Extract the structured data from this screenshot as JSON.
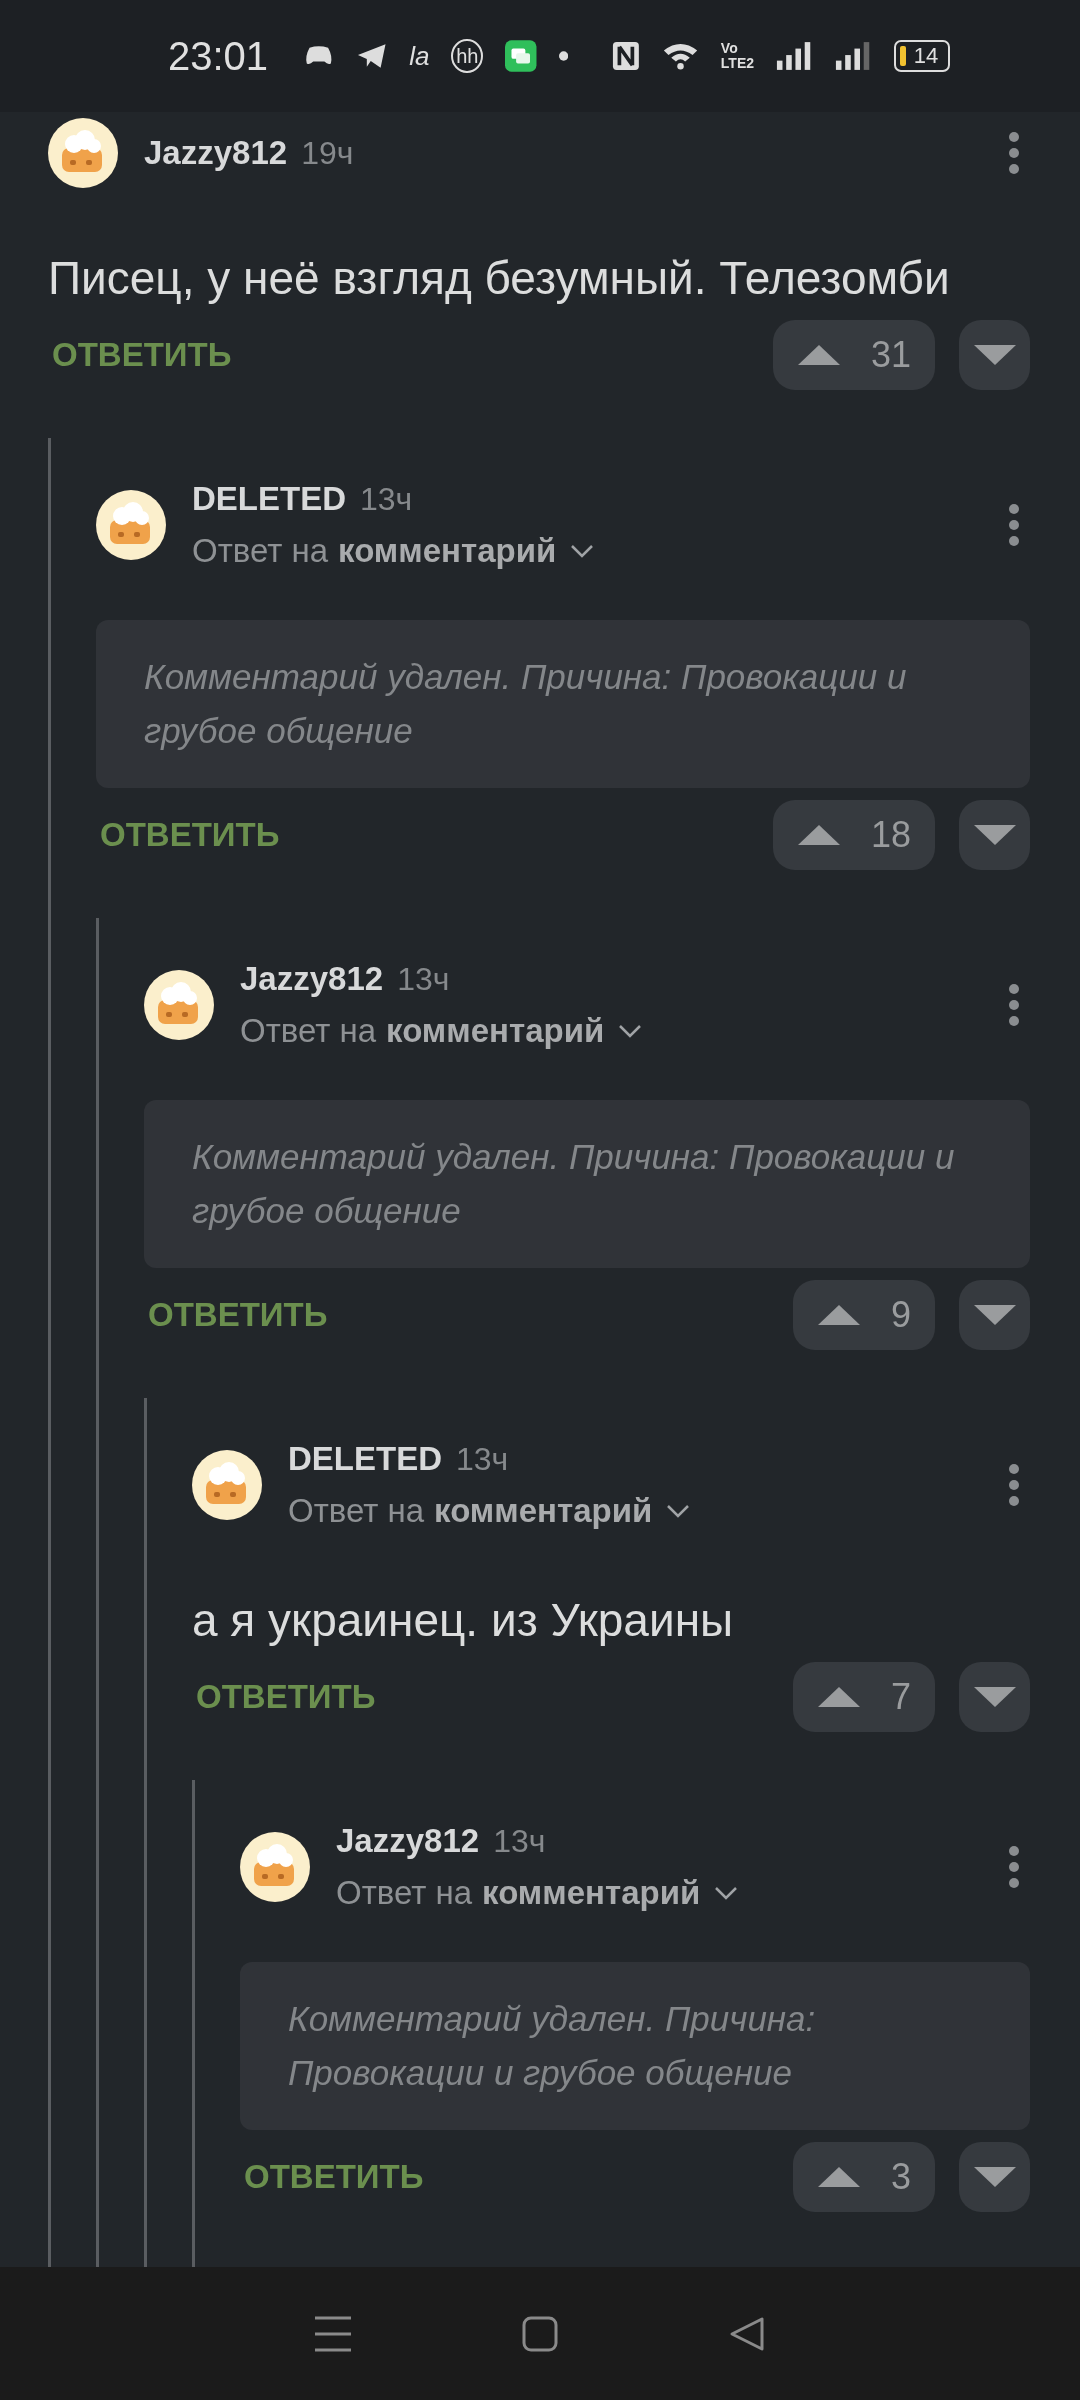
{
  "status_bar": {
    "time": "23:01",
    "app_badges": [
      "la",
      "hh"
    ],
    "volte": [
      "Vo",
      "LTE2"
    ],
    "battery_text": "14"
  },
  "comments": [
    {
      "author": "Jazzy812",
      "time": "19ч",
      "kind": "text",
      "text": "Писец, у неё взгляд безумный. Телезомби",
      "reply_action": "ОТВЕТИТЬ",
      "score": "31",
      "children": [
        {
          "author": "DELETED",
          "time": "13ч",
          "reply_to": {
            "prefix": "Ответ на",
            "link": "комментарий"
          },
          "kind": "deleted",
          "text": "Комментарий удален. Причина: Провокации и грубое общение",
          "reply_action": "ОТВЕТИТЬ",
          "score": "18",
          "children": [
            {
              "author": "Jazzy812",
              "time": "13ч",
              "reply_to": {
                "prefix": "Ответ на",
                "link": "комментарий"
              },
              "kind": "deleted",
              "text": "Комментарий удален. Причина: Провокации и грубое общение",
              "reply_action": "ОТВЕТИТЬ",
              "score": "9",
              "children": [
                {
                  "author": "DELETED",
                  "time": "13ч",
                  "reply_to": {
                    "prefix": "Ответ на",
                    "link": "комментарий"
                  },
                  "kind": "text",
                  "text": "а я украинец. из Украины",
                  "reply_action": "ОТВЕТИТЬ",
                  "score": "7",
                  "children": [
                    {
                      "author": "Jazzy812",
                      "time": "13ч",
                      "reply_to": {
                        "prefix": "Ответ на",
                        "link": "комментарий"
                      },
                      "kind": "deleted",
                      "text": "Комментарий удален. Причина: Провокации и грубое общение",
                      "reply_action": "ОТВЕТИТЬ",
                      "score": "3"
                    }
                  ]
                }
              ]
            }
          ]
        }
      ]
    }
  ]
}
